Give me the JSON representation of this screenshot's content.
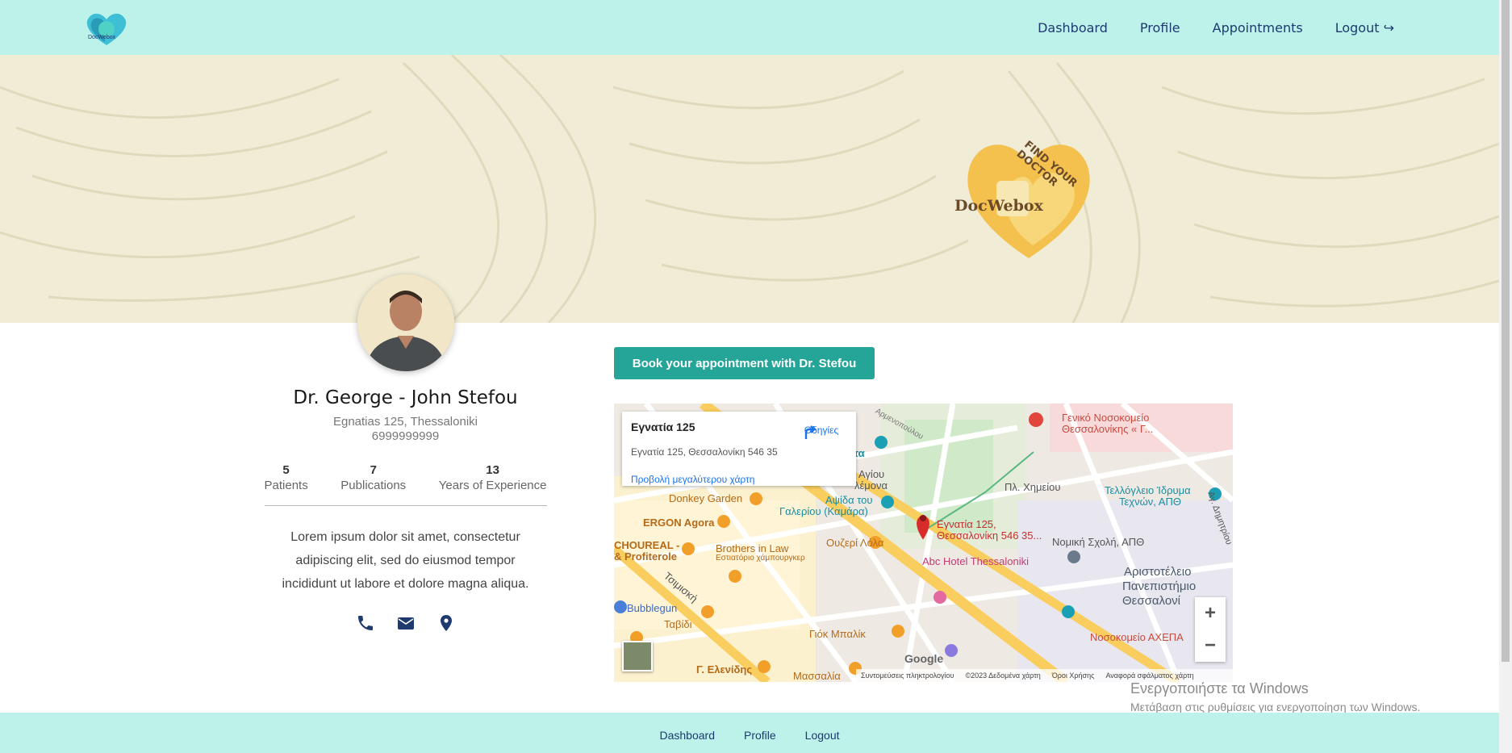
{
  "nav": {
    "logo_icon": "docwebox-logo",
    "links": [
      "Dashboard",
      "Profile",
      "Appointments",
      "Logout ↪"
    ]
  },
  "banner": {
    "brand_name": "DocWebox",
    "tagline": "FIND YOUR DOCTOR"
  },
  "profile": {
    "name": "Dr. George - John Stefou",
    "address": "Egnatias 125, Thessaloniki",
    "phone": "6999999999",
    "stats": [
      {
        "value": "5",
        "label": "Patients"
      },
      {
        "value": "7",
        "label": "Publications"
      },
      {
        "value": "13",
        "label": "Years of Experience"
      }
    ],
    "bio": "Lorem ipsum dolor sit amet, consectetur adipiscing elit, sed do eiusmod tempor incididunt ut labore et dolore magna aliqua.",
    "contact_icons": [
      "phone-icon",
      "envelope-icon",
      "map-marker-icon"
    ]
  },
  "book_button": "Book your appointment with Dr. Stefou",
  "map": {
    "card_title": "Εγνατία 125",
    "card_address": "Εγνατία 125, Θεσσαλονίκη 546 35",
    "directions": "Οδηγίες",
    "larger_map": "Προβολή μεγαλύτερου χάρτη",
    "marker_label_1": "Εγνατία 125,",
    "marker_label_2": "Θεσσαλονίκη 546 35...",
    "places": {
      "hospital": "Γενικό Νοσοκομείο",
      "hospital2": "Θεσσαλονίκης « Γ...",
      "rotonda": "Ροτόντα",
      "agiou": "Αγίου",
      "lemona": "λέμονα",
      "apsida1": "Αψίδα του",
      "apsida2": "Γαλερίου (Καμάρα)",
      "chimeiou": "Πλ. Χημείου",
      "teloglio1": "Τελλόγλειο Ίδρυμα",
      "teloglio2": "Τεχνών, ΑΠΘ",
      "donkey": "Donkey Garden",
      "ergon": "ERGON Agora",
      "choureal1": "CHOUREAL -",
      "choureal2": "& Profiterole",
      "brothers1": "Brothers in Law",
      "brothers2": "Εστιατόριο χάμπουργκερ",
      "ouzeri": "Ουζερί Λόλα",
      "abc": "Abc Hotel Thessaloniki",
      "nomiki": "Νομική Σχολή, ΑΠΘ",
      "aristotle1": "Αριστοτέλειο",
      "aristotle2": "Πανεπιστήμιο",
      "aristotle3": "Θεσσαλονί",
      "bubblegun": "Bubblegun",
      "tsimiski": "Τσιμισκή",
      "tavidi": "Ταβίδι",
      "giok": "Γιόκ Μπαλίκ",
      "axepa": "Νοσοκομείο ΑΧΕΠΑ",
      "elenidis": "Γ. Ελενίδης",
      "massalia": "Μασσαλία",
      "agiou_dimitriou": "Αγ. Δημητρίου",
      "armenopoulou": "Αρμενοπούλου"
    },
    "footer_shortcuts": "Συντομεύσεις πληκτρολογίου",
    "footer_data": "©2023 Δεδομένα χάρτη",
    "footer_terms": "Όροι Χρήσης",
    "footer_report": "Αναφορά σφάλματος χάρτη",
    "google": "Google"
  },
  "windows_watermark": {
    "line1": "Ενεργοποιήστε τα Windows",
    "line2": "Μετάβαση στις ρυθμίσεις για ενεργοποίηση των Windows."
  },
  "footer": {
    "links": [
      "Dashboard",
      "Profile",
      "Logout"
    ]
  }
}
